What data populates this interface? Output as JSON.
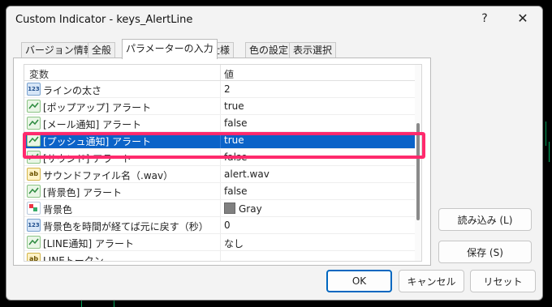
{
  "window": {
    "title": "Custom Indicator - keys_AlertLine",
    "help_label": "?",
    "close_label": "✕"
  },
  "tabs": [
    {
      "label": "バージョン情報"
    },
    {
      "label": "全般"
    },
    {
      "label": "パラメーターの入力"
    },
    {
      "label": "仕様"
    },
    {
      "label": "色の設定"
    },
    {
      "label": "表示選択"
    }
  ],
  "grid": {
    "header_var": "変数",
    "header_val": "値",
    "rows": [
      {
        "name": "ラインの太さ",
        "value": "2",
        "icon": "number-icon"
      },
      {
        "name": "[ポップアップ] アラート",
        "value": "true",
        "icon": "toggle-icon"
      },
      {
        "name": "[メール通知] アラート",
        "value": "false",
        "icon": "toggle-icon"
      },
      {
        "name": "[プッシュ通知] アラート",
        "value": "true",
        "icon": "toggle-icon",
        "selected": true
      },
      {
        "name": "[サウンド] アラート",
        "value": "false",
        "icon": "toggle-icon"
      },
      {
        "name": "サウンドファイル名（.wav）",
        "value": "alert.wav",
        "icon": "text-icon"
      },
      {
        "name": "[背景色] アラート",
        "value": "false",
        "icon": "toggle-icon"
      },
      {
        "name": "背景色",
        "value": "Gray",
        "icon": "color-icon",
        "swatch": "#808080"
      },
      {
        "name": "背景色を時間が経てば元に戻す（秒）",
        "value": "0",
        "icon": "number-icon"
      },
      {
        "name": "[LINE通知] アラート",
        "value": "なし",
        "icon": "toggle-icon"
      },
      {
        "name": "LINEトークン",
        "value": "",
        "icon": "text-icon"
      }
    ]
  },
  "buttons": {
    "load": "読み込み (L)",
    "save": "保存 (S)",
    "ok": "OK",
    "cancel": "キャンセル",
    "reset": "リセット"
  },
  "colors": {
    "selection": "#0b63c8",
    "highlight_frame": "#ff2a6d",
    "primary_border": "#0067c0"
  }
}
